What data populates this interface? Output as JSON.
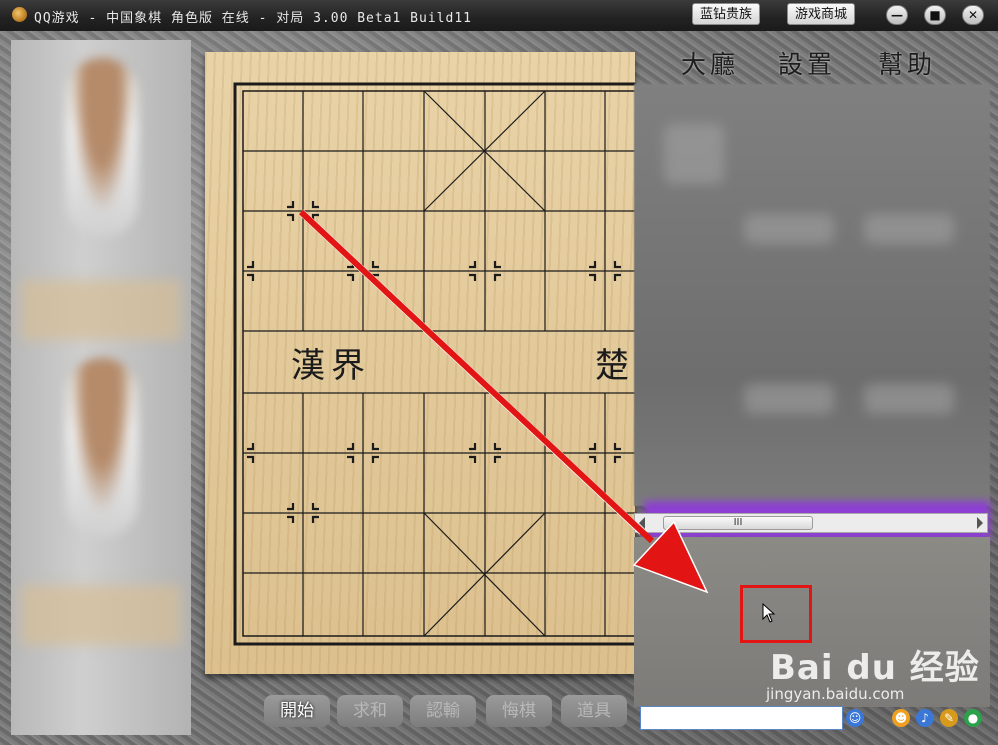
{
  "window": {
    "title": "QQ游戏 - 中国象棋 角色版 在线 - 对局 3.00 Beta1 Build11",
    "buttons": {
      "vip": "蓝钻贵族",
      "mall": "游戏商城"
    },
    "controls": {
      "minimize": "—",
      "maximize": "■",
      "close": "✕"
    }
  },
  "menu": {
    "lobby": "大廳",
    "settings": "設置",
    "help": "幫助"
  },
  "board": {
    "river_left": "漢界",
    "river_right": "楚"
  },
  "actions": [
    {
      "label": "開始",
      "enabled": true
    },
    {
      "label": "求和",
      "enabled": false
    },
    {
      "label": "認輸",
      "enabled": false
    },
    {
      "label": "悔棋",
      "enabled": false
    },
    {
      "label": "道具",
      "enabled": false
    }
  ],
  "scrollbar": {
    "thumb_grip": "III"
  },
  "chat": {
    "input_value": ""
  },
  "watermark": {
    "logo": "Bai du 经验",
    "url": "jingyan.baidu.com"
  },
  "colors": {
    "highlight": "#e21414",
    "arrow": "#e21414",
    "purple_bar": "#8d3fd4"
  },
  "icons": [
    "app-icon",
    "scroll-left-icon",
    "scroll-right-icon",
    "mouse-cursor-icon",
    "emoticon-icon",
    "face-icon",
    "volume-icon",
    "tool-icon",
    "qq-icon"
  ]
}
